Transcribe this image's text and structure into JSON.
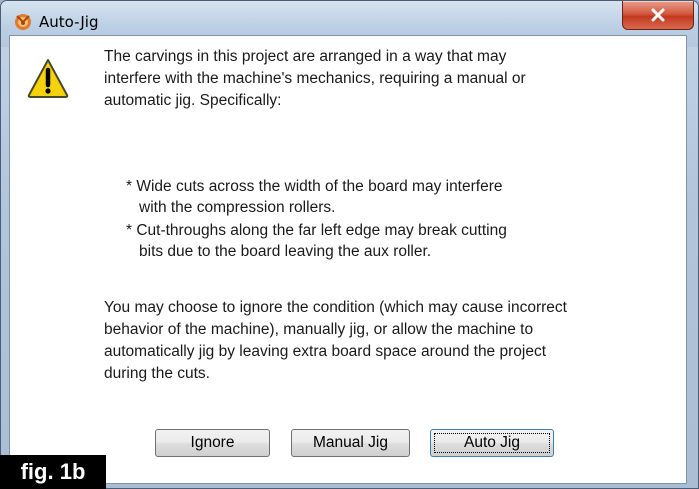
{
  "window": {
    "title": "Auto-Jig",
    "close_symbol": "x"
  },
  "icons": {
    "app": "app-logo-icon",
    "warning": "warning-icon",
    "close": "close-icon"
  },
  "message": {
    "intro_lines": [
      "The carvings in this project are arranged in a way that may",
      "interfere with the machine's mechanics, requiring a manual or",
      "automatic jig.  Specifically:"
    ],
    "bullets": [
      [
        "* Wide cuts across the width of the board may interfere",
        "with the compression rollers."
      ],
      [
        "* Cut-throughs along the far left edge may break cutting",
        "bits due to the board leaving the aux roller."
      ]
    ],
    "choice_lines": [
      "You may choose to ignore the condition (which may cause incorrect",
      "behavior of the machine), manually jig, or allow the machine to",
      "automatically jig by leaving extra board space around the project",
      "during the cuts."
    ]
  },
  "buttons": {
    "ignore": "Ignore",
    "manual": "Manual Jig",
    "auto": "Auto Jig"
  },
  "figure_label": "fig. 1b",
  "colors": {
    "close_button": "#c2391f",
    "warning_fill": "#f5d20c",
    "figure_label_bg": "#000000"
  }
}
